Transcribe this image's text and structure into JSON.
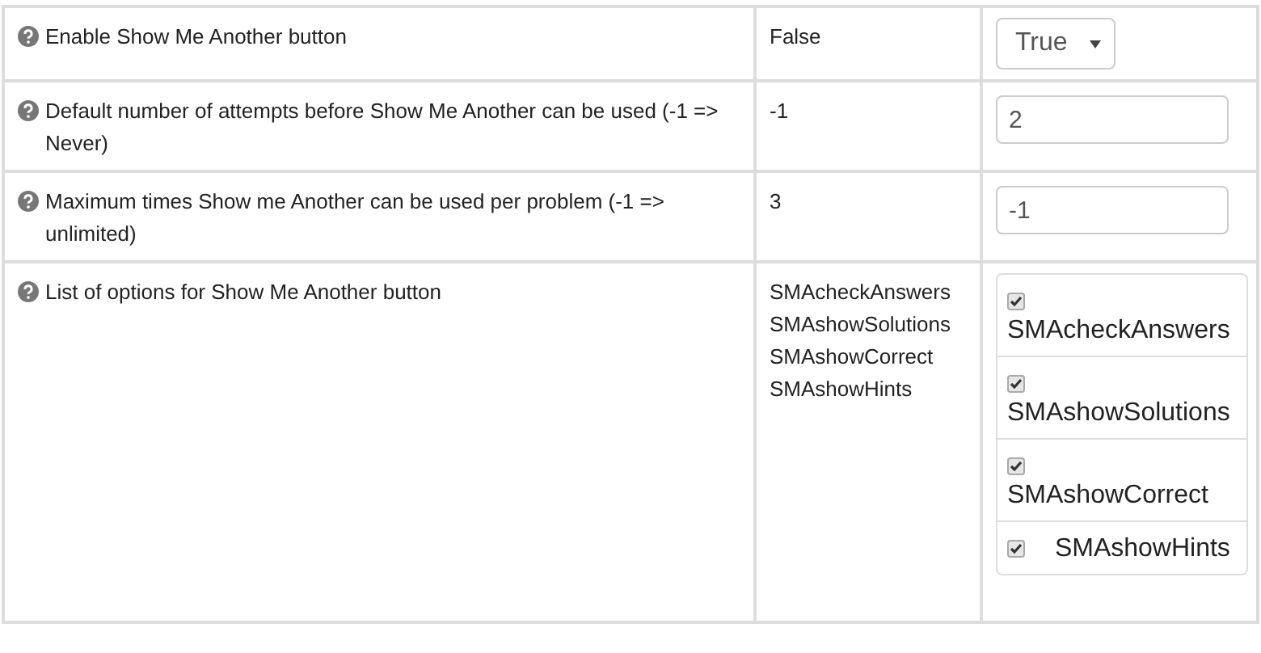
{
  "settings": [
    {
      "label": "Enable Show Me Another button",
      "default": "False",
      "control": {
        "kind": "select",
        "value": "True"
      }
    },
    {
      "label": "Default number of attempts before Show Me Another can be used (-1 => Never)",
      "default": "-1",
      "control": {
        "kind": "text",
        "value": "2"
      }
    },
    {
      "label": "Maximum times Show me Another can be used per problem (-1 => unlimited)",
      "default": "3",
      "control": {
        "kind": "text",
        "value": "-1"
      }
    },
    {
      "label": "List of options for Show Me Another button",
      "default_lines": [
        "SMAcheckAnswers",
        "SMAshowSolutions",
        "SMAshowCorrect",
        "SMAshowHints"
      ],
      "control": {
        "kind": "checklist",
        "options": [
          {
            "label": "SMAcheckAnswers",
            "checked": true
          },
          {
            "label": "SMAshowSolutions",
            "checked": true
          },
          {
            "label": "SMAshowCorrect",
            "checked": true
          },
          {
            "label": "SMAshowHints",
            "checked": true
          }
        ]
      }
    }
  ]
}
